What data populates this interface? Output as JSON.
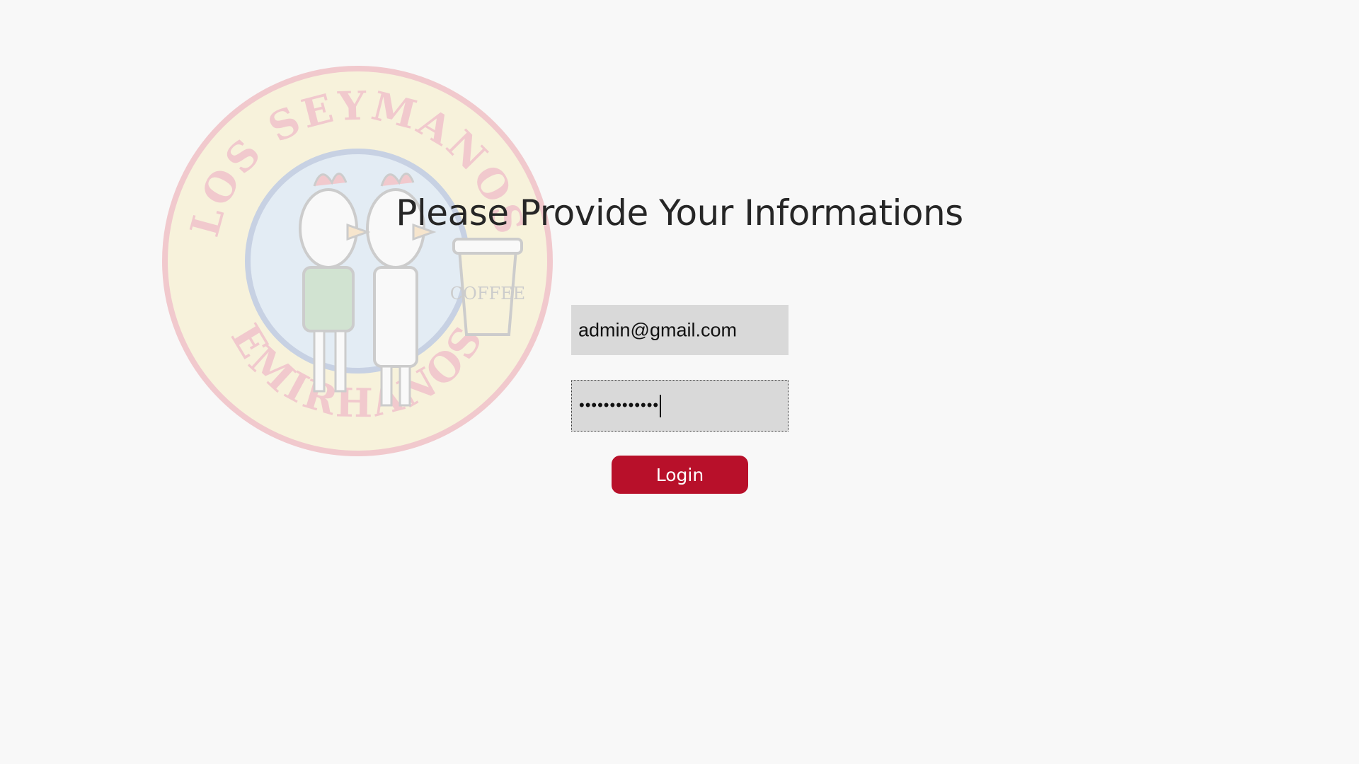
{
  "heading": "Please Provide Your Informations",
  "logo": {
    "top_text": "LOS SEYMANOS",
    "bottom_text": "EMIRHANOS",
    "cup_text": "COFFEE"
  },
  "form": {
    "email_value": "admin@gmail.com",
    "password_masked": "•••••••••••••",
    "login_label": "Login"
  },
  "colors": {
    "background": "#f8f8f8",
    "field_bg": "#d9d9d9",
    "button": "#b8102a"
  }
}
